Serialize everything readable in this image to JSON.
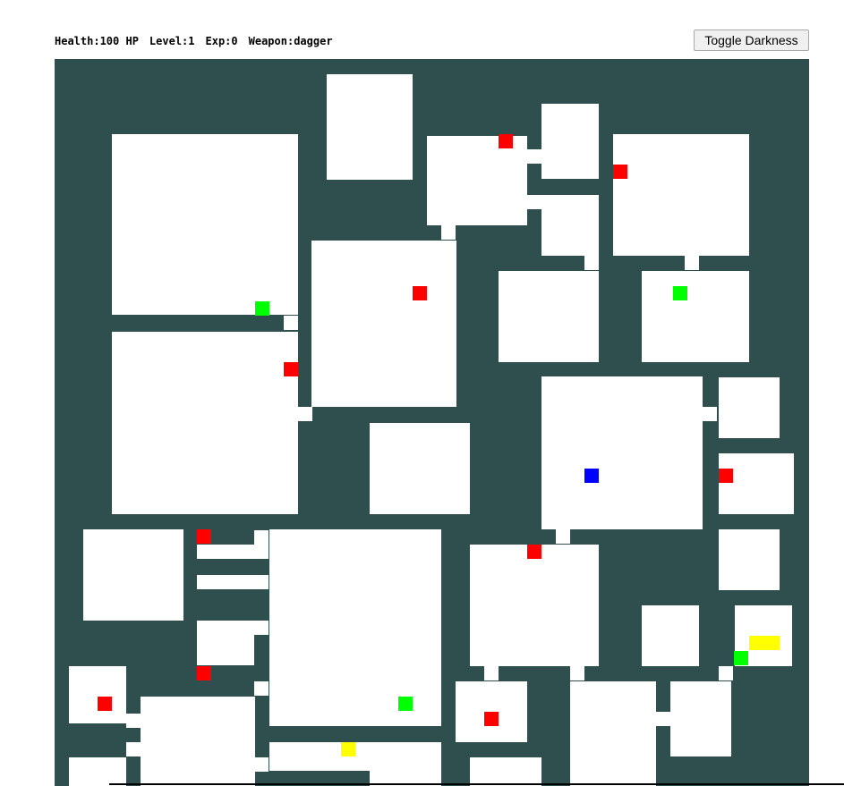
{
  "hud": {
    "health": "Health:100 HP",
    "level": "Level:1",
    "exp": "Exp:0",
    "weapon": "Weapon:dagger"
  },
  "toggle_button": {
    "label": "Toggle Darkness"
  },
  "colors": {
    "wall": "#2f4f4f",
    "floor": "#ffffff",
    "player": "#0000ff",
    "enemy": "#ff0000",
    "health": "#00ff00",
    "weapon": "#ffff00",
    "boss": "#ffff00"
  },
  "map": {
    "player_count": 1,
    "enemy_count": 12,
    "health_count": 5,
    "weapon_count": 1,
    "boss_count": 1
  }
}
